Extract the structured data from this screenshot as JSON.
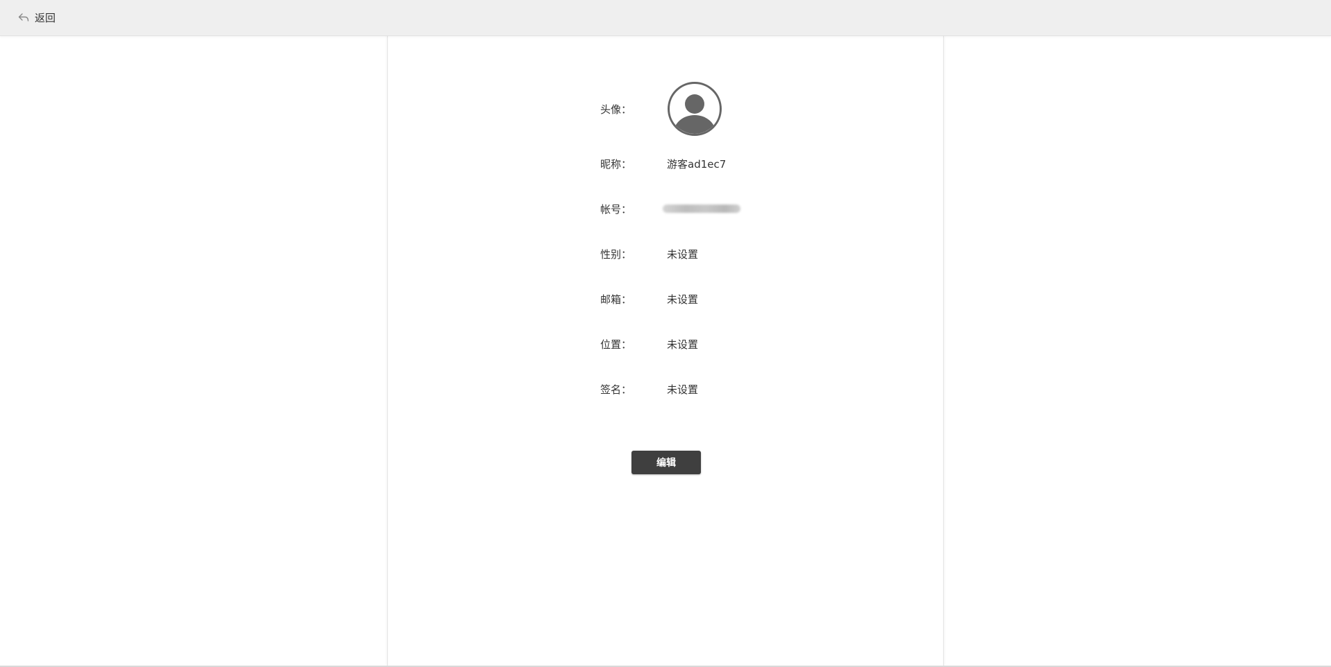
{
  "topbar": {
    "back_label": "返回",
    "back_icon": "reply-arrow-icon"
  },
  "profile": {
    "avatar_label": "头像：",
    "avatar_icon": "user-avatar-icon",
    "fields": [
      {
        "key": "nickname",
        "label": "昵称：",
        "value": "游客ad1ec7"
      },
      {
        "key": "account",
        "label": "帐号：",
        "value": ""
      },
      {
        "key": "gender",
        "label": "性别：",
        "value": "未设置"
      },
      {
        "key": "email",
        "label": "邮箱：",
        "value": "未设置"
      },
      {
        "key": "location",
        "label": "位置：",
        "value": "未设置"
      },
      {
        "key": "signature",
        "label": "签名：",
        "value": "未设置"
      }
    ],
    "edit_label": "编辑"
  },
  "colors": {
    "topbar_bg": "#efefef",
    "button_bg": "#3f3f3f",
    "avatar_gray": "#666666"
  }
}
